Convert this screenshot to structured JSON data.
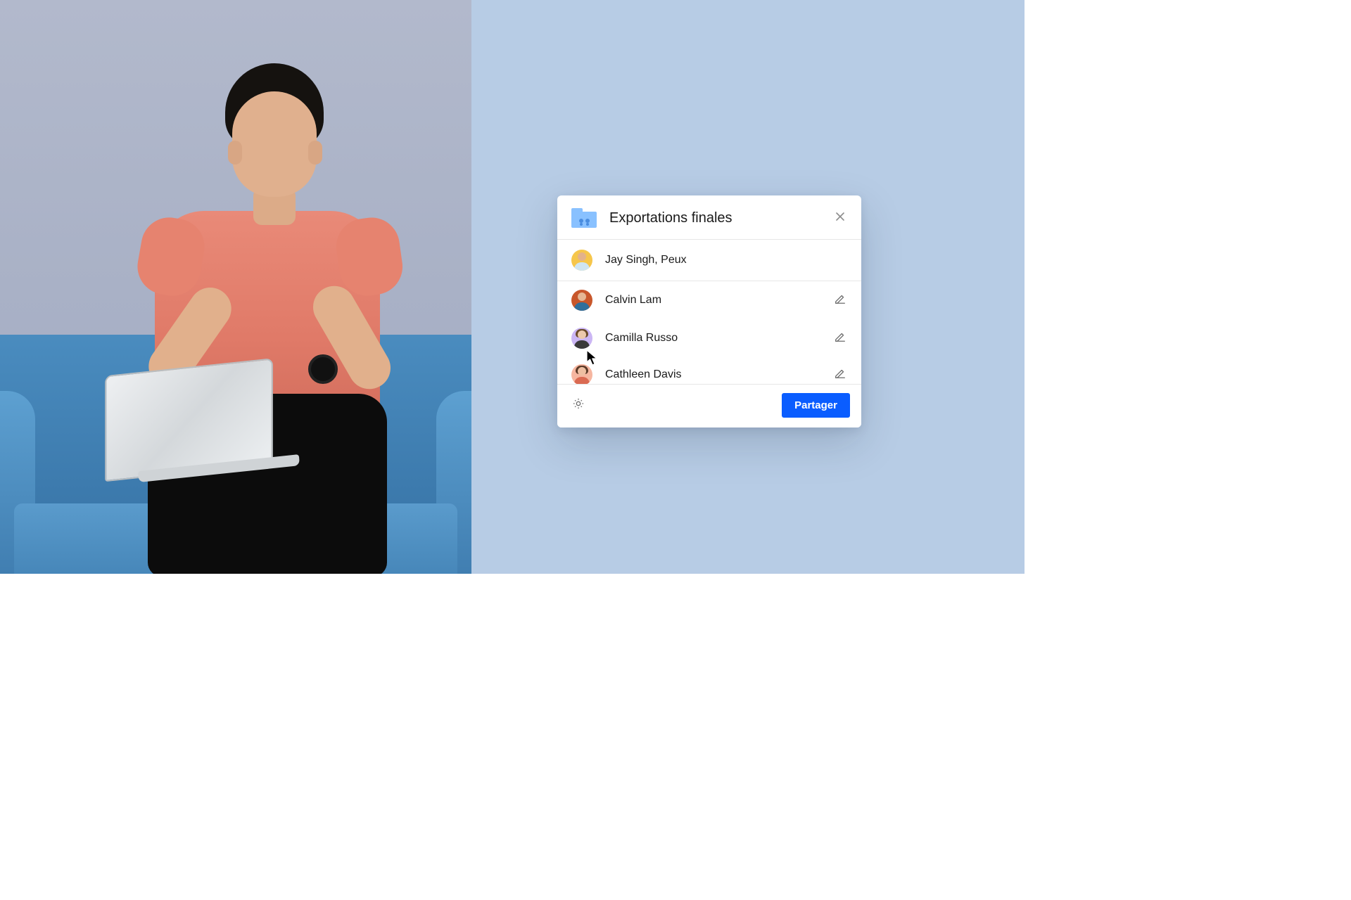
{
  "dialog": {
    "title": "Exportations finales",
    "input_value": "Jay Singh, Peux",
    "people": [
      {
        "name": "Calvin Lam"
      },
      {
        "name": "Camilla Russo"
      },
      {
        "name": "Cathleen Davis"
      }
    ],
    "share_label": "Partager"
  }
}
